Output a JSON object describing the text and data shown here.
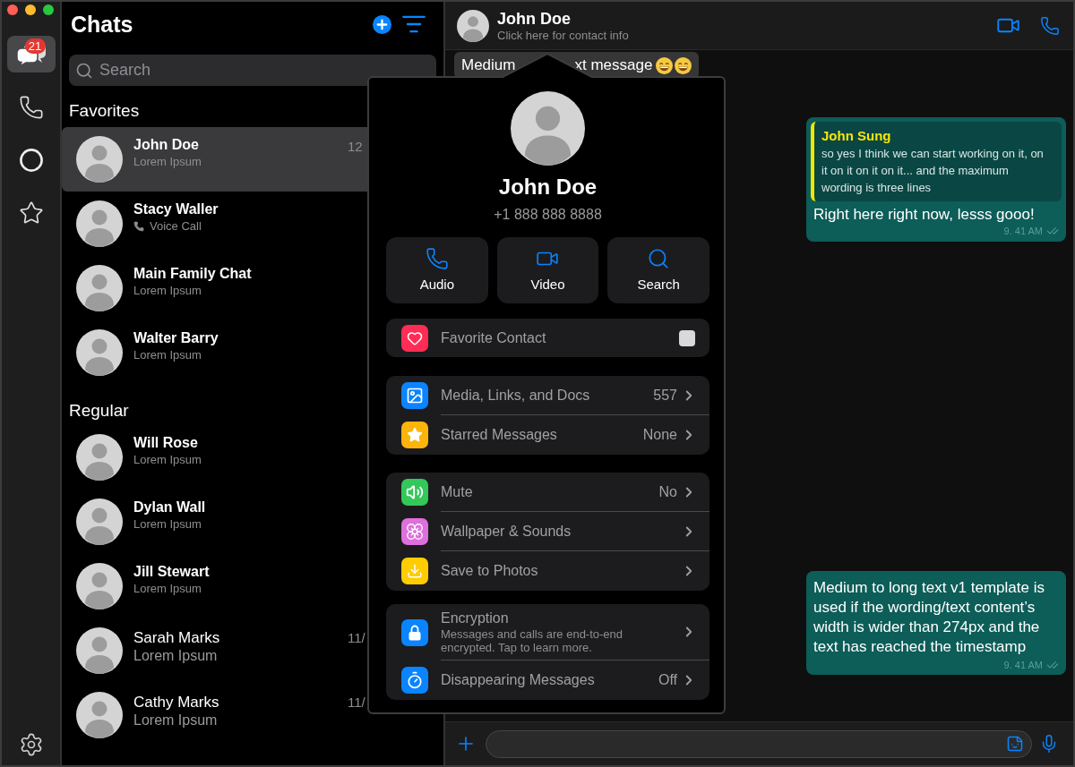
{
  "rail": {
    "items": [
      {
        "kind": "chats",
        "selected": true,
        "badge": "21"
      },
      {
        "kind": "calls",
        "selected": false
      },
      {
        "kind": "status",
        "selected": false
      },
      {
        "kind": "starred",
        "selected": false
      }
    ]
  },
  "chat_list": {
    "title": "Chats",
    "search": {
      "placeholder": "Search"
    },
    "sections": [
      {
        "title": "Favorites",
        "chats": [
          {
            "name": "John Doe",
            "kind": "text",
            "preview": "Lorem Ipsum",
            "time": "12",
            "bold_name": true,
            "selected": true
          },
          {
            "name": "Stacy Waller",
            "kind": "call",
            "preview": "Voice Call",
            "bold_name": true,
            "selected": false
          },
          {
            "name": "Main Family Chat",
            "kind": "text",
            "preview": "Lorem Ipsum",
            "bold_name": true,
            "selected": false
          },
          {
            "name": "Walter Barry",
            "kind": "text",
            "preview": "Lorem Ipsum",
            "bold_name": true,
            "selected": false
          }
        ]
      },
      {
        "title": "Regular",
        "chats": [
          {
            "name": "Will Rose",
            "kind": "text",
            "preview": "Lorem Ipsum",
            "bold_name": true,
            "selected": false
          },
          {
            "name": "Dylan Wall",
            "kind": "text",
            "preview": "Lorem Ipsum",
            "bold_name": true,
            "selected": false
          },
          {
            "name": "Jill Stewart",
            "kind": "text",
            "preview": "Lorem Ipsum",
            "bold_name": true,
            "selected": false
          },
          {
            "name": "Sarah Marks",
            "kind": "text",
            "preview": "Lorem Ipsum",
            "time": "11/",
            "bold_name": false,
            "selected": false
          },
          {
            "name": "Cathy Marks",
            "kind": "text",
            "preview": "Lorem Ipsum",
            "time": "11/",
            "bold_name": false,
            "selected": false
          }
        ]
      }
    ]
  },
  "chat": {
    "header": {
      "name": "John Doe",
      "subtitle": "Click here for contact info"
    },
    "messages": [
      {
        "kind": "incoming",
        "text_start": "Medium",
        "text_end": "xt message"
      },
      {
        "kind": "reply",
        "quote_author": "John Sung",
        "quote_text": "so yes I think we can start working on it, on it on it on it on it... and the maximum wording is three lines",
        "text": "Right here right now, lesss gooo!",
        "time": "9. 41 AM"
      },
      {
        "kind": "outgoing",
        "text": "Medium to long text v1 template is used if the wording/text content’s width is wider than 274px and the text has reached the timestamp",
        "time": "9. 41 AM"
      }
    ]
  },
  "contact_popover": {
    "name": "John Doe",
    "phone": "+1 888 888 8888",
    "actions": [
      {
        "kind": "audio",
        "label": "Audio"
      },
      {
        "kind": "video",
        "label": "Video"
      },
      {
        "kind": "search",
        "label": "Search"
      }
    ],
    "favorite": {
      "label": "Favorite Contact",
      "checked": false
    },
    "groups": [
      {
        "rows": [
          {
            "kind": "media",
            "label": "Media, Links, and Docs",
            "value": "557"
          },
          {
            "kind": "starred",
            "label": "Starred Messages",
            "value": "None"
          }
        ]
      },
      {
        "rows": [
          {
            "kind": "mute",
            "label": "Mute",
            "value": "No"
          },
          {
            "kind": "wallpaper",
            "label": "Wallpaper & Sounds"
          },
          {
            "kind": "save",
            "label": "Save to Photos"
          }
        ]
      },
      {
        "rows": [
          {
            "kind": "encryption",
            "label": "Encryption",
            "description": "Messages and calls are end-to-end encrypted. Tap to learn more."
          },
          {
            "kind": "disappearing",
            "label": "Disappearing Messages",
            "value": "Off"
          }
        ]
      }
    ]
  }
}
